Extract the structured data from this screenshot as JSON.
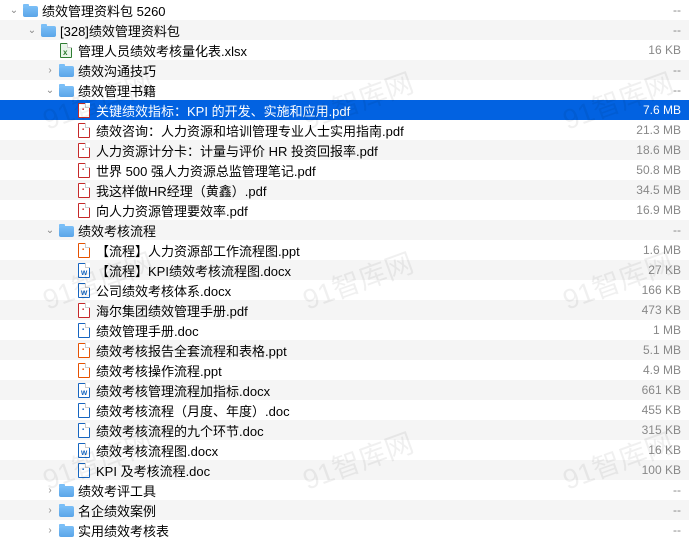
{
  "watermark": "91智库网",
  "rows": [
    {
      "level": 0,
      "expand": "down",
      "type": "folder",
      "name": "绩效管理资料包 5260",
      "size": "--",
      "alt": false
    },
    {
      "level": 1,
      "expand": "down",
      "type": "folder",
      "name": "[328]绩效管理资料包",
      "size": "--",
      "alt": true
    },
    {
      "level": 2,
      "expand": "",
      "type": "xlsx",
      "name": "管理人员绩效考核量化表.xlsx",
      "size": "16 KB",
      "alt": false
    },
    {
      "level": 2,
      "expand": "right",
      "type": "folder",
      "name": "绩效沟通技巧",
      "size": "--",
      "alt": true
    },
    {
      "level": 2,
      "expand": "down",
      "type": "folder",
      "name": "绩效管理书籍",
      "size": "--",
      "alt": false
    },
    {
      "level": 3,
      "expand": "",
      "type": "pdf",
      "name": "关键绩效指标：KPI 的开发、实施和应用.pdf",
      "size": "7.6 MB",
      "alt": true,
      "selected": true
    },
    {
      "level": 3,
      "expand": "",
      "type": "pdf",
      "name": "绩效咨询：人力资源和培训管理专业人士实用指南.pdf",
      "size": "21.3 MB",
      "alt": false
    },
    {
      "level": 3,
      "expand": "",
      "type": "pdf",
      "name": "人力资源计分卡：计量与评价 HR 投资回报率.pdf",
      "size": "18.6 MB",
      "alt": true
    },
    {
      "level": 3,
      "expand": "",
      "type": "pdf",
      "name": "世界 500 强人力资源总监管理笔记.pdf",
      "size": "50.8 MB",
      "alt": false
    },
    {
      "level": 3,
      "expand": "",
      "type": "pdf",
      "name": "我这样做HR经理（黄鑫）.pdf",
      "size": "34.5 MB",
      "alt": true
    },
    {
      "level": 3,
      "expand": "",
      "type": "pdf",
      "name": "向人力资源管理要效率.pdf",
      "size": "16.9 MB",
      "alt": false
    },
    {
      "level": 2,
      "expand": "down",
      "type": "folder",
      "name": "绩效考核流程",
      "size": "--",
      "alt": true
    },
    {
      "level": 3,
      "expand": "",
      "type": "ppt",
      "name": "【流程】人力资源部工作流程图.ppt",
      "size": "1.6 MB",
      "alt": false
    },
    {
      "level": 3,
      "expand": "",
      "type": "docx",
      "name": "【流程】KPI绩效考核流程图.docx",
      "size": "27 KB",
      "alt": true
    },
    {
      "level": 3,
      "expand": "",
      "type": "docx",
      "name": "公司绩效考核体系.docx",
      "size": "166 KB",
      "alt": false
    },
    {
      "level": 3,
      "expand": "",
      "type": "pdf",
      "name": "海尔集团绩效管理手册.pdf",
      "size": "473 KB",
      "alt": true
    },
    {
      "level": 3,
      "expand": "",
      "type": "doc",
      "name": "绩效管理手册.doc",
      "size": "1 MB",
      "alt": false
    },
    {
      "level": 3,
      "expand": "",
      "type": "ppt",
      "name": "绩效考核报告全套流程和表格.ppt",
      "size": "5.1 MB",
      "alt": true
    },
    {
      "level": 3,
      "expand": "",
      "type": "ppt",
      "name": "绩效考核操作流程.ppt",
      "size": "4.9 MB",
      "alt": false
    },
    {
      "level": 3,
      "expand": "",
      "type": "docx",
      "name": "绩效考核管理流程加指标.docx",
      "size": "661 KB",
      "alt": true
    },
    {
      "level": 3,
      "expand": "",
      "type": "doc",
      "name": "绩效考核流程（月度、年度）.doc",
      "size": "455 KB",
      "alt": false
    },
    {
      "level": 3,
      "expand": "",
      "type": "doc",
      "name": "绩效考核流程的九个环节.doc",
      "size": "315 KB",
      "alt": true
    },
    {
      "level": 3,
      "expand": "",
      "type": "docx",
      "name": "绩效考核流程图.docx",
      "size": "16 KB",
      "alt": false
    },
    {
      "level": 3,
      "expand": "",
      "type": "doc",
      "name": "KPI 及考核流程.doc",
      "size": "100 KB",
      "alt": true
    },
    {
      "level": 2,
      "expand": "right",
      "type": "folder",
      "name": "绩效考评工具",
      "size": "--",
      "alt": false
    },
    {
      "level": 2,
      "expand": "right",
      "type": "folder",
      "name": "名企绩效案例",
      "size": "--",
      "alt": true
    },
    {
      "level": 2,
      "expand": "right",
      "type": "folder",
      "name": "实用绩效考核表",
      "size": "--",
      "alt": false
    }
  ]
}
